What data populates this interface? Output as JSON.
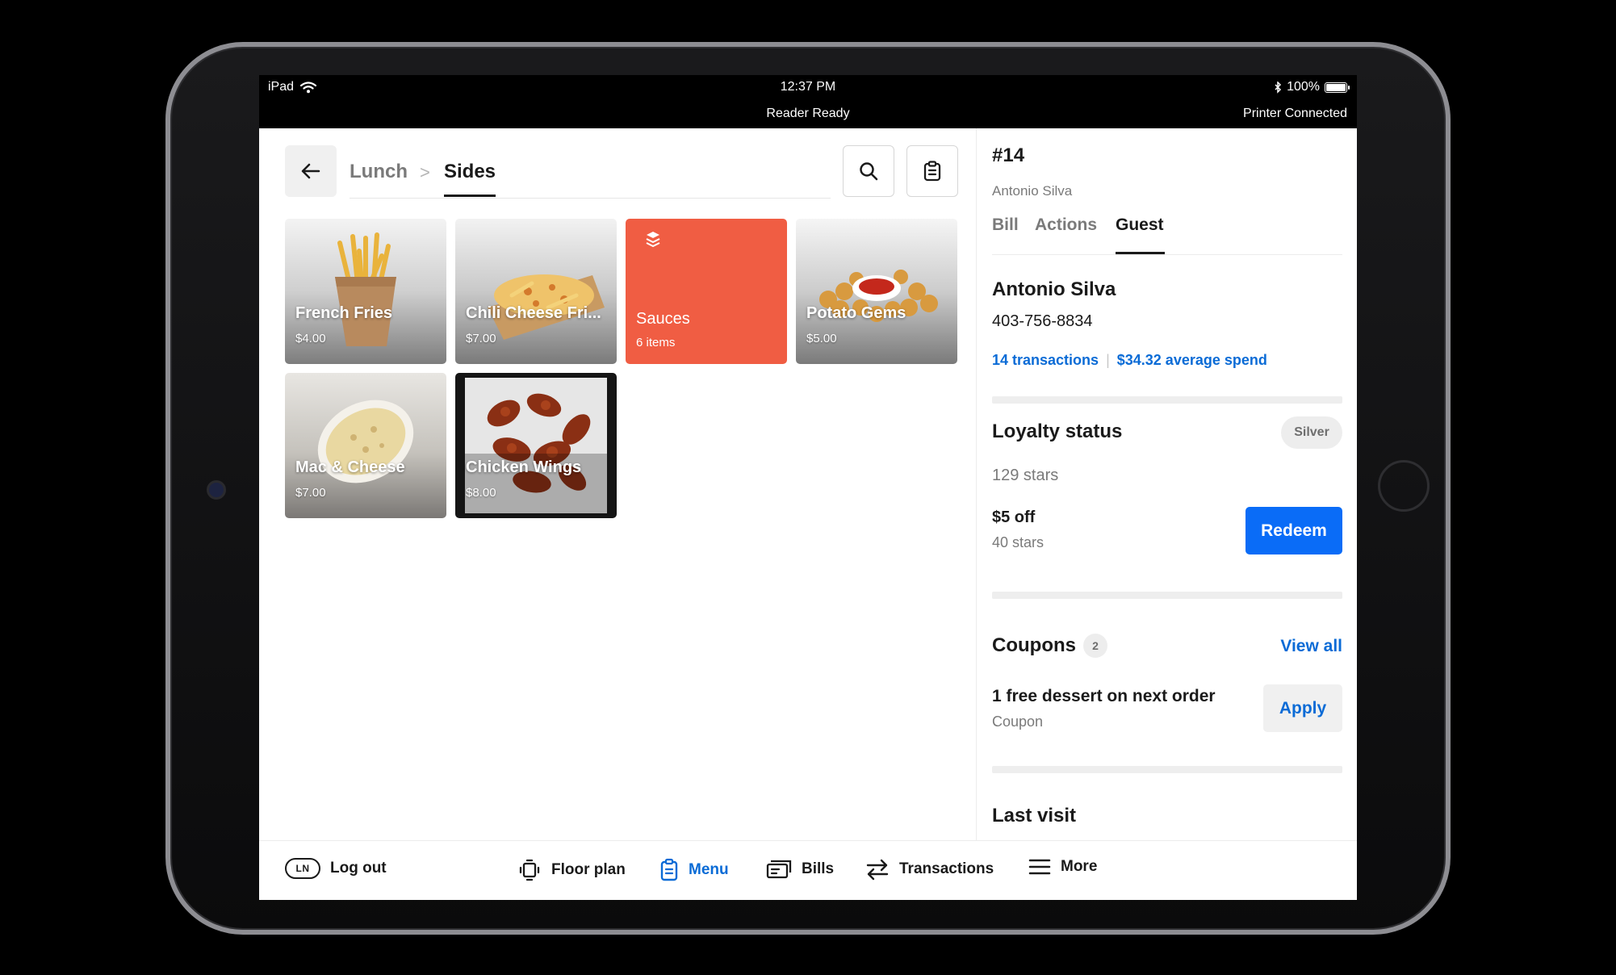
{
  "status_bar": {
    "device": "iPad",
    "time": "12:37 PM",
    "battery": "100%",
    "reader": "Reader Ready",
    "printer": "Printer Connected"
  },
  "header": {
    "breadcrumb_parent": "Lunch",
    "breadcrumb_separator": ">",
    "breadcrumb_current": "Sides"
  },
  "tiles": [
    {
      "name": "French Fries",
      "price": "$4.00"
    },
    {
      "name": "Chili Cheese Fri...",
      "price": "$7.00"
    },
    {
      "name": "Sauces",
      "price": "6 items",
      "color": "#f05d43"
    },
    {
      "name": "Potato Gems",
      "price": "$5.00"
    },
    {
      "name": "Mac & Cheese",
      "price": "$7.00"
    },
    {
      "name": "Chicken Wings",
      "price": "$8.00"
    }
  ],
  "order": {
    "number": "#14",
    "customer": "Antonio Silva",
    "tabs": [
      "Bill",
      "Actions",
      "Guest"
    ],
    "active_tab": "Guest"
  },
  "guest": {
    "name": "Antonio Silva",
    "phone": "403-756-8834",
    "transactions": "14 transactions",
    "average_spend": "$34.32 average spend"
  },
  "loyalty": {
    "title": "Loyalty status",
    "tier": "Silver",
    "stars": "129 stars",
    "reward_title": "$5 off",
    "reward_cost": "40 stars",
    "redeem_label": "Redeem"
  },
  "coupons": {
    "title": "Coupons",
    "count": "2",
    "view_all": "View all",
    "item_title": "1 free dessert on next order",
    "item_type": "Coupon",
    "apply_label": "Apply"
  },
  "last_visit": {
    "title": "Last visit"
  },
  "bottom_nav": {
    "initials": "LN",
    "logout": "Log out",
    "floor_plan": "Floor plan",
    "menu": "Menu",
    "bills": "Bills",
    "transactions": "Transactions",
    "more": "More"
  },
  "colors": {
    "accent": "#0a6cf7",
    "link": "#0a6bd6",
    "sauces_tile": "#f05d43"
  }
}
